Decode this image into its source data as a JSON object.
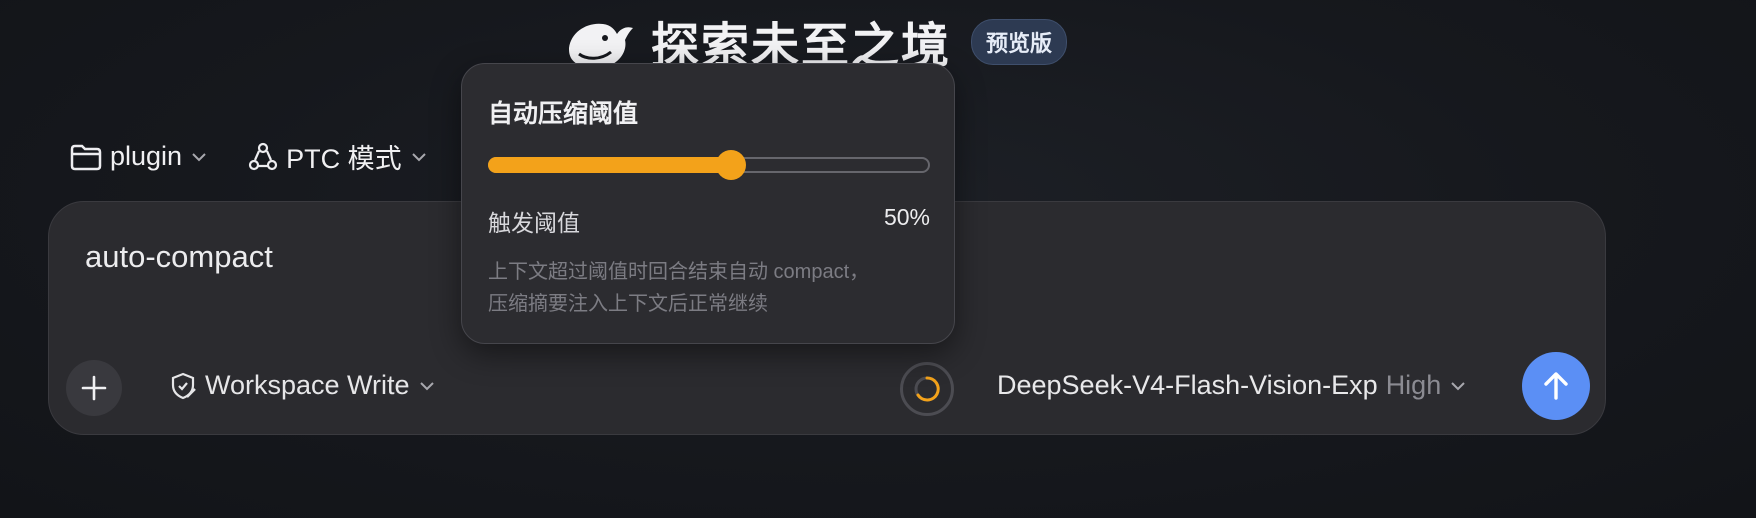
{
  "header": {
    "title": "探索未至之境",
    "badge": "预览版",
    "logo_icon": "whale-logo-icon"
  },
  "toolbar": {
    "folder": {
      "label": "plugin",
      "icon": "folder-icon"
    },
    "mode": {
      "label": "PTC 模式",
      "icon": "nodes-icon"
    }
  },
  "composer": {
    "input_value": "auto-compact",
    "permission": {
      "label": "Workspace Write",
      "icon": "shield-edit-icon"
    },
    "model": {
      "name": "DeepSeek-V4-Flash-Vision-Exp",
      "level": "High"
    },
    "colors": {
      "send": "#5b8ff5",
      "accent": "#f3a21a"
    }
  },
  "popover": {
    "title": "自动压缩阈值",
    "slider_value": 0.55,
    "trigger_label": "触发阈值",
    "trigger_value": "50%",
    "desc_line1": "上下文超过阈值时回合结束自动 compact，",
    "desc_line2": "压缩摘要注入上下文后正常继续"
  }
}
